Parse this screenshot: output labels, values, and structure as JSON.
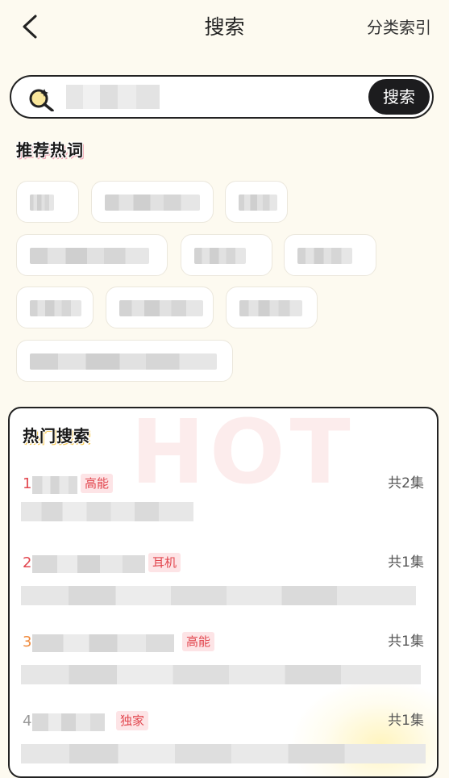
{
  "header": {
    "back_icon": "chevron-left-icon",
    "title": "搜索",
    "index_link": "分类索引"
  },
  "search": {
    "icon": "search-sparkle-icon",
    "button_label": "搜索",
    "input_value": ""
  },
  "hot_words": {
    "title": "推荐热词",
    "chips": [
      "",
      "",
      "",
      "",
      "",
      "",
      "",
      "",
      "",
      ""
    ]
  },
  "hot_search": {
    "title": "热门搜索",
    "watermark": "HOT",
    "items": [
      {
        "rank": "1",
        "rank_color": "#e2474f",
        "tag": "高能",
        "count": "共2集"
      },
      {
        "rank": "2",
        "rank_color": "#e2474f",
        "tag": "耳机",
        "count": "共1集"
      },
      {
        "rank": "3",
        "rank_color": "#f08a3c",
        "tag": "高能",
        "count": "共1集"
      },
      {
        "rank": "4",
        "rank_color": "#999999",
        "tag": "独家",
        "count": "共1集"
      }
    ]
  },
  "colors": {
    "background": "#fdfaf0",
    "accent_dark": "#1c1c1e",
    "tag_bg": "#fde4e6",
    "tag_text": "#e2474f"
  }
}
